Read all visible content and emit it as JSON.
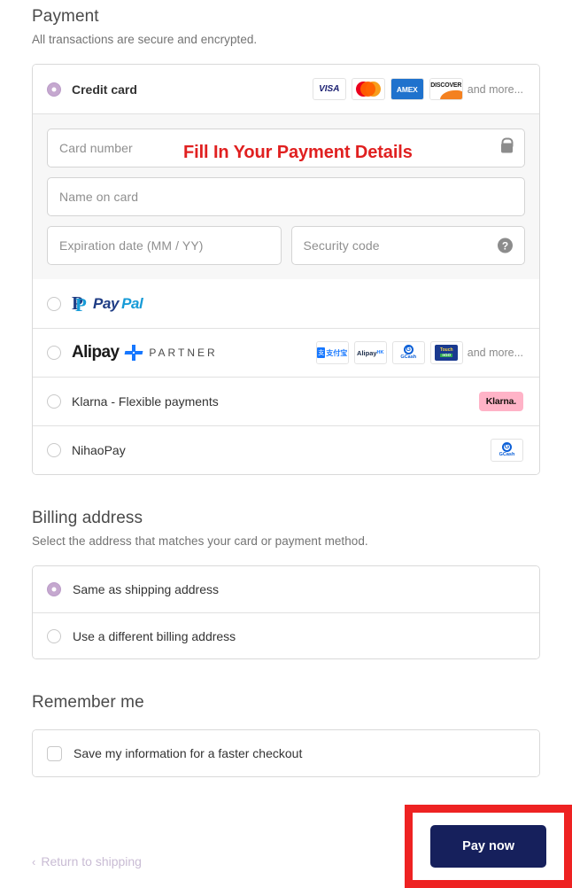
{
  "payment": {
    "title": "Payment",
    "subtitle": "All transactions are secure and encrypted.",
    "methods": [
      {
        "label": "Credit card",
        "selected": true
      },
      {
        "label": "PayPal",
        "selected": false
      },
      {
        "label": "Alipay",
        "partner_label": "PARTNER",
        "selected": false
      },
      {
        "label": "Klarna - Flexible payments",
        "badge": "Klarna.",
        "selected": false
      },
      {
        "label": "NihaoPay",
        "selected": false
      }
    ],
    "card_brands": [
      "VISA",
      "Mastercard",
      "AMEX",
      "DISCOVER"
    ],
    "card_brands_more": "and more...",
    "alipay_brands": [
      "支付宝",
      "Alipay HK",
      "GCash",
      "Touch 'n Go"
    ],
    "alipay_brands_more": "and more...",
    "nihaopay_brand": "GCash",
    "form": {
      "card_number_placeholder": "Card number",
      "name_on_card_placeholder": "Name on card",
      "expiration_placeholder": "Expiration date (MM / YY)",
      "security_code_placeholder": "Security code",
      "lock_icon": "lock-icon",
      "help_icon": "question-mark-icon"
    }
  },
  "annotation": {
    "text": "Fill In Your Payment Details",
    "color": "#e02020"
  },
  "billing": {
    "title": "Billing address",
    "subtitle": "Select the address that matches your card or payment method.",
    "options": [
      {
        "label": "Same as shipping address",
        "selected": true
      },
      {
        "label": "Use a different billing address",
        "selected": false
      }
    ]
  },
  "remember": {
    "title": "Remember me",
    "checkbox_label": "Save my information for a faster checkout",
    "checked": false
  },
  "footer": {
    "return_link": "Return to shipping",
    "chevron": "‹",
    "pay_button": "Pay now",
    "highlight_color": "#ee2222",
    "button_color": "#16205c"
  },
  "brand_text": {
    "visa": "VISA",
    "amex": "AMEX",
    "discover": "DISCOVER",
    "alipay_cn_mark": "支",
    "alipay_cn_text": "支付宝",
    "alipay_hk": "Alipay",
    "alipay_hk_sub": "HK",
    "gcash_mark": "G",
    "gcash_text": "GCash",
    "tng_top": "Touch",
    "tng_bottom": "nGO",
    "paypal_first": "Pay",
    "paypal_second": "Pal",
    "paypal_mark_back": "P",
    "paypal_mark_front": "P",
    "alipay_name": "Alipay"
  }
}
